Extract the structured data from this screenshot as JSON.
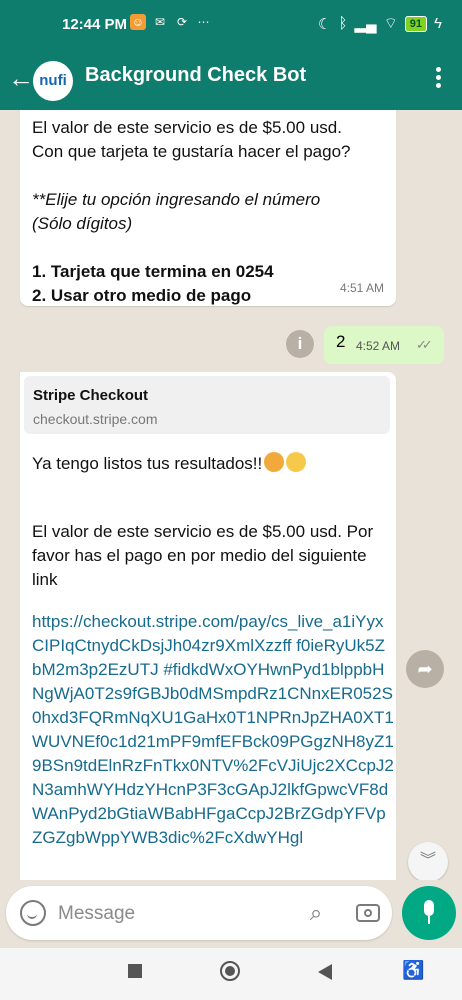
{
  "status": {
    "time": "12:44 PM",
    "battery": "91"
  },
  "header": {
    "logo_text": "nufi",
    "title": "Background Check Bot"
  },
  "messages": {
    "m1": {
      "line1": "El valor de este servicio es de $5.00 usd.",
      "line2": "Con que tarjeta te gustaría hacer el pago?",
      "note1": "**Elije tu opción ingresando el número",
      "note2": "(Sólo dígitos)",
      "opt1": "1.  Tarjeta que termina en 0254",
      "opt2": "2.  Usar otro medio de pago",
      "time": "4:51 AM"
    },
    "m2": {
      "text": "2",
      "time": "4:52 AM"
    },
    "m3": {
      "preview_title": "Stripe Checkout",
      "preview_url": "checkout.stripe.com",
      "line1": "Ya tengo listos tus resultados!!",
      "line2": "El valor de este servicio es de $5.00 usd. Por favor has el pago en por medio del siguiente link",
      "link": "https://checkout.stripe.com/pay/cs_live_a1iYyxCIPIqCtnydCkDsjJh04zr9XmlXzzff f0ieRyUk5ZbM2m3p2EzUTJ #fidkdWxOYHwnPyd1blppbHNgWjA0T2s9fGBJb0dMSmpdRz1CNnxER052S0hxd3FQRmNqXU1GaHx0T1NPRnJpZHA0XT1WUVNEf0c1d21mPF9mfEFBck09PGgzNH8yZ19BSn9tdElnRzFnTkx0NTV%2FcVJiUjc2XCcpJ2N3amhWYHdzYHcnP3F3cGApJ2lkfGpwcVF8dWAnPyd2bGtiaWBabHFgaCcpJ2BrZGdpYFVpZGZgbWppYWB3dic%2FcXdwYHgl"
    }
  },
  "composer": {
    "placeholder": "Message"
  },
  "colors": {
    "header": "#0f7d6e",
    "outgoing": "#dcf8c6",
    "link": "#176b8f",
    "mic": "#00a884"
  }
}
